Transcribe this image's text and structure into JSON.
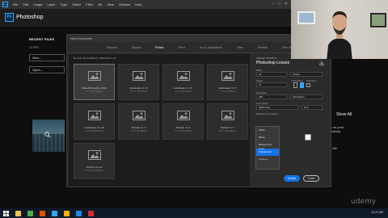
{
  "app": {
    "name": "Photoshop",
    "logo_text": "Ps",
    "menu": [
      "File",
      "Edit",
      "Image",
      "Layer",
      "Type",
      "Select",
      "Filter",
      "3D",
      "View",
      "Window",
      "Help"
    ]
  },
  "left_panel": {
    "recent_title": "RECENT FILES",
    "recent_item": "10 PM",
    "new_button": "New...",
    "open_button": "Open..."
  },
  "right_panel": {
    "show_all": "Show All",
    "text": "Lens on your Photoshop",
    "help": "Help Me"
  },
  "dialog": {
    "title": "New Document",
    "tabs": [
      {
        "label": "Recent",
        "active": false
      },
      {
        "label": "Saved",
        "active": false
      },
      {
        "label": "Photo",
        "active": true
      },
      {
        "label": "Print",
        "active": false
      },
      {
        "label": "Art & Illustration",
        "active": false
      },
      {
        "label": "Web",
        "active": false
      },
      {
        "label": "Mobile",
        "active": false
      },
      {
        "label": "Film & Video",
        "active": false
      }
    ],
    "presets_label": "BLANK DOCUMENT PRESETS (9)",
    "presets": [
      {
        "name": "Default Photoshop Size",
        "dims": "7 x 5 in @ 300 ppi",
        "selected": true
      },
      {
        "name": "Landscape, 2 x 3",
        "dims": "3 x 2 in @ 300 ppi",
        "selected": false
      },
      {
        "name": "Landscape, 4 x 6",
        "dims": "6 x 4 in @ 300 ppi",
        "selected": false
      },
      {
        "name": "Landscape, 5 x 7",
        "dims": "7 x 5 in @ 300 ppi",
        "selected": false
      },
      {
        "name": "Landscape, 8 x 10",
        "dims": "10 x 8 in @ 300 ppi",
        "selected": false
      },
      {
        "name": "Portrait, 2 x 3",
        "dims": "2 x 3 in @ 300 ppi",
        "selected": false
      },
      {
        "name": "Portrait, 4 x 6",
        "dims": "4 x 6 in @ 300 ppi",
        "selected": false
      },
      {
        "name": "Portrait, 5 x 7",
        "dims": "5 x 7 in @ 300 ppi",
        "selected": false
      },
      {
        "name": "Portrait, 8 x 10",
        "dims": "8 x 10 in @ 300 ppi",
        "selected": false
      }
    ],
    "details": {
      "section_label": "PRESET DETAILS",
      "doc_name": "Photoshop Lesson",
      "width_label": "Width",
      "width_value": "16",
      "width_unit": "Inches",
      "height_label": "Height",
      "height_value": "12",
      "orientation_label": "Orientation",
      "artboards_label": "Artboards",
      "resolution_label": "Resolution",
      "resolution_value": "300",
      "resolution_unit": "Pixels/Inch",
      "color_mode_label": "Color Mode",
      "color_mode_value": "RGB Color",
      "bit_depth": "8 bit",
      "background_label": "Background Contents"
    },
    "dropdown": [
      "White",
      "Black",
      "Background Color",
      "Transparent",
      "Custom..."
    ],
    "dropdown_highlighted": 3,
    "swatch_color": "#ffffff",
    "create_button": "Create",
    "close_button": "Close"
  },
  "taskbar": {
    "clock": "10:21 AM",
    "apps": [
      {
        "icon": "file-explorer-icon",
        "color": "#f2c14e"
      },
      {
        "icon": "chrome-icon",
        "color": "#4caf50"
      },
      {
        "icon": "media-icon",
        "color": "#e65100"
      },
      {
        "icon": "photoshop-icon",
        "color": "#31a8ff"
      },
      {
        "icon": "folder-icon",
        "color": "#ffb300"
      },
      {
        "icon": "mail-icon",
        "color": "#1e88e5"
      },
      {
        "icon": "video-icon",
        "color": "#d32f2f"
      }
    ]
  },
  "watermark": "udemy",
  "colors": {
    "accent": "#1473e6",
    "ps_blue": "#31a8ff"
  }
}
